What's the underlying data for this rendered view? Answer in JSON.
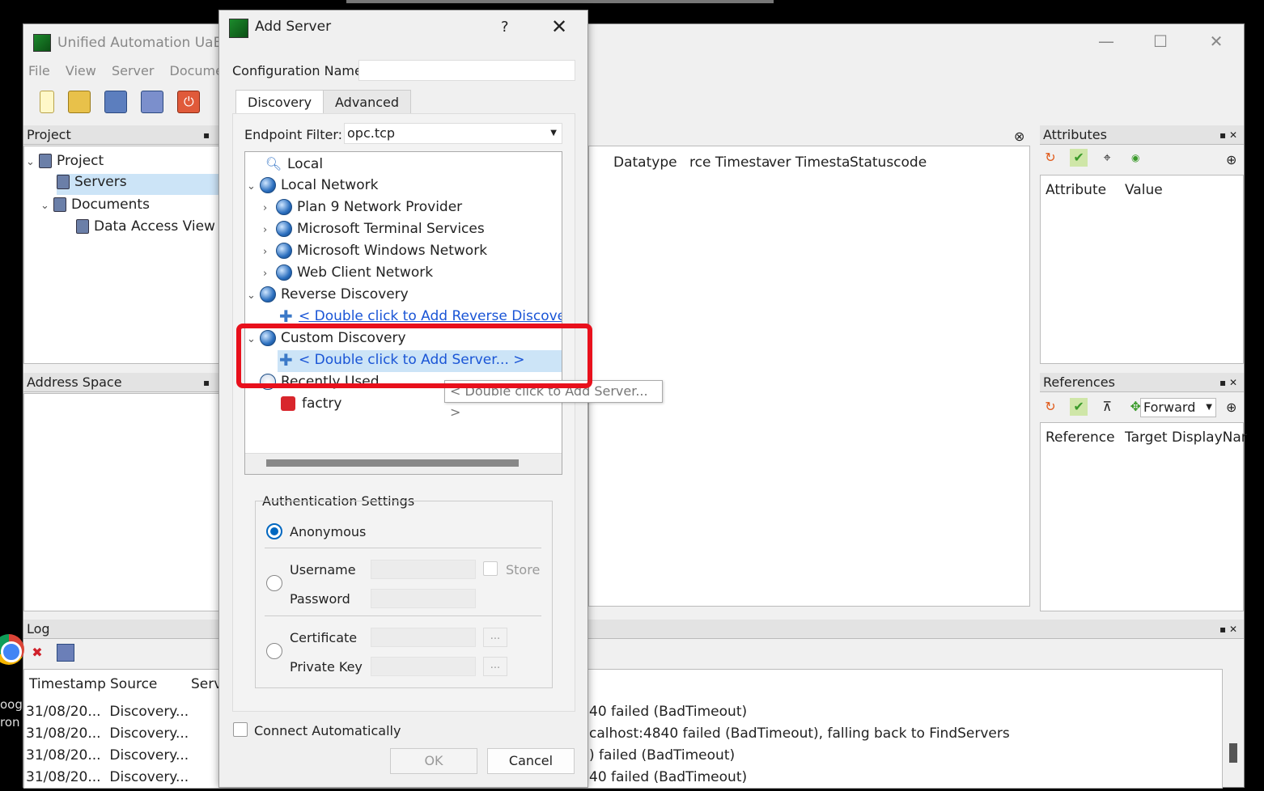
{
  "main_window": {
    "title": "Unified Automation UaEx",
    "menu": [
      "File",
      "View",
      "Server",
      "Documer"
    ],
    "controls": [
      "—",
      "☐",
      "✕"
    ]
  },
  "project_pane": {
    "title": "Project",
    "tree": [
      {
        "label": "Project"
      },
      {
        "label": "Servers"
      },
      {
        "label": "Documents"
      },
      {
        "label": "Data Access View"
      }
    ]
  },
  "address_space_pane": {
    "title": "Address Space"
  },
  "data_view": {
    "columns": [
      "Datatype",
      "rce Timesta",
      "ver Timesta",
      "Statuscode"
    ]
  },
  "attributes_pane": {
    "title": "Attributes",
    "columns": [
      "Attribute",
      "Value"
    ]
  },
  "references_pane": {
    "title": "References",
    "direction": "Forward",
    "columns": [
      "Reference",
      "Target DisplayNar"
    ]
  },
  "log_pane": {
    "title": "Log",
    "columns": [
      "Timestamp",
      "Source",
      "Serv"
    ],
    "rows": [
      {
        "timestamp": "31/08/20...",
        "source": "Discovery...",
        "message": "40 failed (BadTimeout)"
      },
      {
        "timestamp": "31/08/20...",
        "source": "Discovery...",
        "message": "calhost:4840 failed (BadTimeout), falling back to FindServers"
      },
      {
        "timestamp": "31/08/20...",
        "source": "Discovery...",
        "message": ") failed (BadTimeout)"
      },
      {
        "timestamp": "31/08/20...",
        "source": "Discovery...",
        "message": "40 failed (BadTimeout)"
      }
    ]
  },
  "desktop": {
    "text1": "oog",
    "text2": "ron"
  },
  "dialog": {
    "title": "Add Server",
    "help": "?",
    "close": "✕",
    "config_name_label": "Configuration Name",
    "config_name_value": "",
    "tabs": [
      "Discovery",
      "Advanced"
    ],
    "endpoint_filter_label": "Endpoint Filter:",
    "endpoint_filter_value": "opc.tcp",
    "tree": {
      "local": "Local",
      "local_network": "Local Network",
      "plan9": "Plan 9 Network Provider",
      "ms_terminal": "Microsoft Terminal Services",
      "ms_windows": "Microsoft Windows Network",
      "web_client": "Web Client Network",
      "reverse_discovery": "Reverse Discovery",
      "reverse_add": "< Double click to Add Reverse Discovery",
      "custom_discovery": "Custom Discovery",
      "custom_add": "< Double click to Add Server... >",
      "recently_used": "Recently Used",
      "factry": "factry"
    },
    "tooltip": "< Double click to Add Server... >",
    "auth": {
      "title": "Authentication Settings",
      "anonymous": "Anonymous",
      "username": "Username",
      "password": "Password",
      "store": "Store",
      "certificate": "Certificate",
      "private_key": "Private Key",
      "ellipsis": "..."
    },
    "connect_auto": "Connect Automatically",
    "ok": "OK",
    "cancel": "Cancel"
  }
}
